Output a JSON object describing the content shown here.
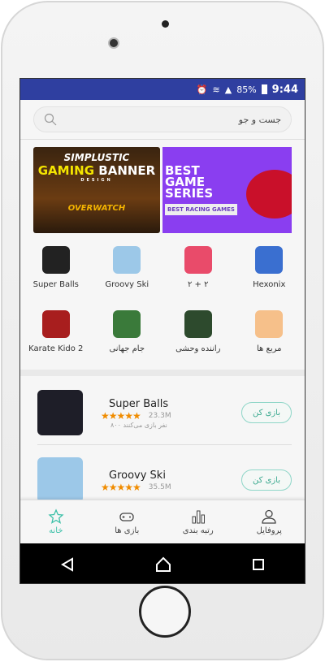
{
  "status": {
    "battery": "85%",
    "time": "9:44"
  },
  "search": {
    "placeholder": "جست و جو"
  },
  "banners": [
    {
      "line1": "SIMPLUSTIC",
      "line2a": "GAMING",
      "line2b": "BANNER",
      "sub": "DESIGN",
      "game": "OVERWATCH"
    },
    {
      "title": "BEST GAME SERIES",
      "tag": "BEST RACING GAMES"
    }
  ],
  "grid": [
    {
      "label": "Super Balls",
      "color": "#222"
    },
    {
      "label": "Groovy Ski",
      "color": "#9cc8e8"
    },
    {
      "label": "۲ + ۲",
      "color": "#e94b6a"
    },
    {
      "label": "Hexonix",
      "color": "#3a6fd0"
    },
    {
      "label": "Karate Kido 2",
      "color": "#a81e1e"
    },
    {
      "label": "جام جهانی",
      "color": "#3a7a3a"
    },
    {
      "label": "راننده وحشی",
      "color": "#2d4a2d"
    },
    {
      "label": "مربع ها",
      "color": "#f6c08a"
    }
  ],
  "list": [
    {
      "name": "Super Balls",
      "rating": 5,
      "size": "23.3M",
      "players": "۸۰۰ نفر بازی می‌کنند",
      "button": "بازی کن",
      "color": "#1e1e28"
    },
    {
      "name": "Groovy Ski",
      "rating": 5,
      "size": "35.5M",
      "button": "بازی کن",
      "color": "#9cc8e8"
    }
  ],
  "tabs": [
    {
      "label": "خانه",
      "active": true
    },
    {
      "label": "بازی ها"
    },
    {
      "label": "رتبه بندی"
    },
    {
      "label": "پروفایل"
    }
  ],
  "colors": {
    "statusbar": "#2f3fa0",
    "accent": "#3cc0a8",
    "star": "#f08c00"
  }
}
